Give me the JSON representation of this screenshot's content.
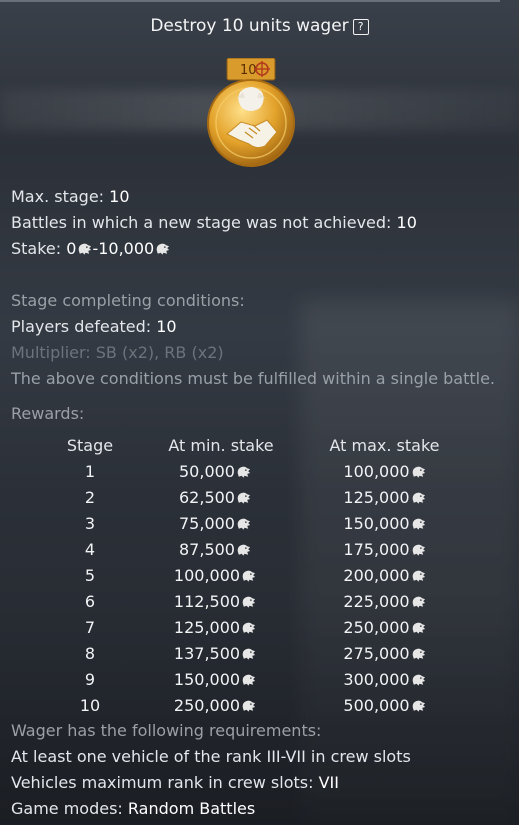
{
  "title": "Destroy 10 units wager",
  "help_icon": "question-box-icon",
  "badge": {
    "number": "10",
    "icon": "handshake-medal-icon"
  },
  "currency_icon": "lion-icon",
  "info": {
    "max_stage_label": "Max. stage: ",
    "max_stage_value": "10",
    "battles_label": "Battles in which a new stage was not achieved: ",
    "battles_value": "10",
    "stake_label": "Stake: ",
    "stake_min": "0",
    "stake_max": "10,000"
  },
  "conditions": {
    "header": "Stage completing conditions:",
    "players_label": "Players defeated: ",
    "players_value": "10",
    "multiplier": "Multiplier: SB (x2), RB (x2)",
    "note": "The above conditions must be fulfilled within a single battle."
  },
  "rewards": {
    "header": "Rewards:",
    "columns": [
      "Stage",
      "At min. stake",
      "At max. stake"
    ],
    "rows": [
      {
        "stage": "1",
        "min": "50,000",
        "max": "100,000"
      },
      {
        "stage": "2",
        "min": "62,500",
        "max": "125,000"
      },
      {
        "stage": "3",
        "min": "75,000",
        "max": "150,000"
      },
      {
        "stage": "4",
        "min": "87,500",
        "max": "175,000"
      },
      {
        "stage": "5",
        "min": "100,000",
        "max": "200,000"
      },
      {
        "stage": "6",
        "min": "112,500",
        "max": "225,000"
      },
      {
        "stage": "7",
        "min": "125,000",
        "max": "250,000"
      },
      {
        "stage": "8",
        "min": "137,500",
        "max": "275,000"
      },
      {
        "stage": "9",
        "min": "150,000",
        "max": "300,000"
      },
      {
        "stage": "10",
        "min": "250,000",
        "max": "500,000"
      }
    ]
  },
  "requirements": {
    "header": "Wager has the following requirements:",
    "rank_text": "At least one vehicle of the rank III-VII in crew slots",
    "max_rank_label": "Vehicles maximum rank in crew slots: ",
    "max_rank_value": "VII",
    "modes_label": "Game modes: ",
    "modes_value": "Random Battles"
  },
  "colors": {
    "gold": "#e3a22a",
    "text": "#e9ecef",
    "dim": "#9aa0a6",
    "disabled": "#6d737a"
  }
}
